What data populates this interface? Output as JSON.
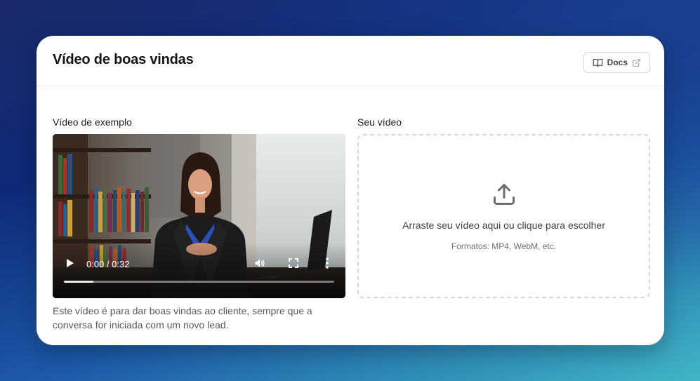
{
  "header": {
    "title": "Vídeo de boas vindas",
    "docs_label": "Docs",
    "docs_icon": "book-open-icon",
    "docs_external_icon": "external-link-icon"
  },
  "example": {
    "label": "Vídeo de exemplo",
    "player": {
      "time": "0:00 / 0:32",
      "buffered": 0.11,
      "icons": [
        "play-icon",
        "volume-icon",
        "fullscreen-icon",
        "more-vertical-icon"
      ]
    },
    "caption": "Este vídeo é para dar boas vindas ao cliente, sempre que a conversa for iniciada com um novo lead."
  },
  "upload": {
    "label": "Seu vídeo",
    "icon": "upload-icon",
    "title": "Arraste seu vídeo aqui ou clique para escolher",
    "formats": "Formatos: MP4, WebM, etc."
  },
  "colors": {
    "card_bg": "#ffffff",
    "border": "#e3e5e8",
    "dropzone_border": "#d4d7db"
  }
}
